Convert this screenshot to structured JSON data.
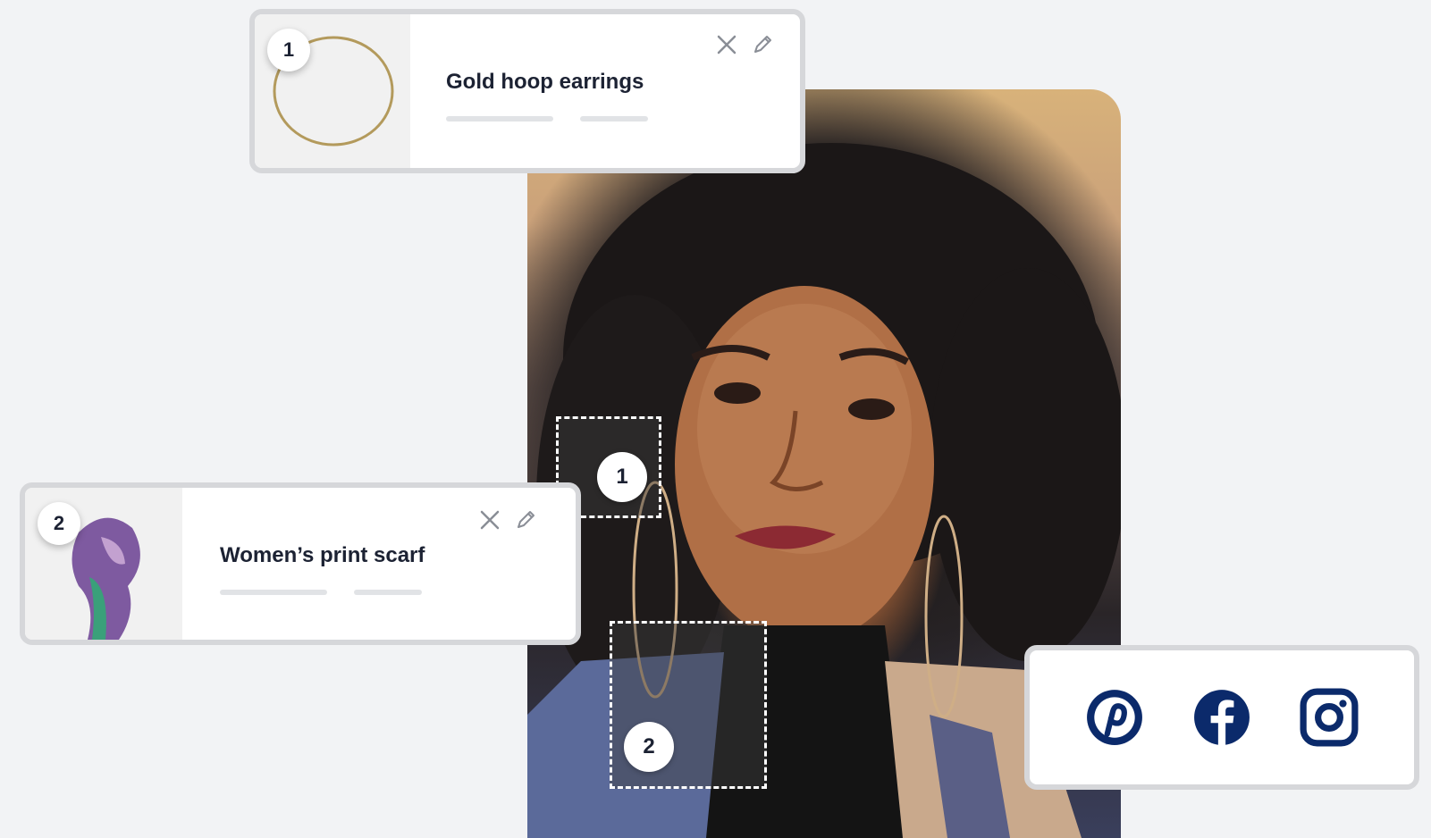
{
  "products": [
    {
      "number": "1",
      "name": "Gold hoop earrings"
    },
    {
      "number": "2",
      "name": "Women’s print scarf"
    }
  ],
  "tags": [
    {
      "number": "1"
    },
    {
      "number": "2"
    }
  ],
  "icons": {
    "close": "close-icon",
    "edit": "pencil-icon",
    "social": [
      "pinterest-icon",
      "facebook-icon",
      "instagram-icon"
    ]
  },
  "colors": {
    "brand_navy": "#0b2a6b",
    "text": "#1c2233",
    "card_border": "#d6d7da",
    "background": "#f2f3f5"
  }
}
